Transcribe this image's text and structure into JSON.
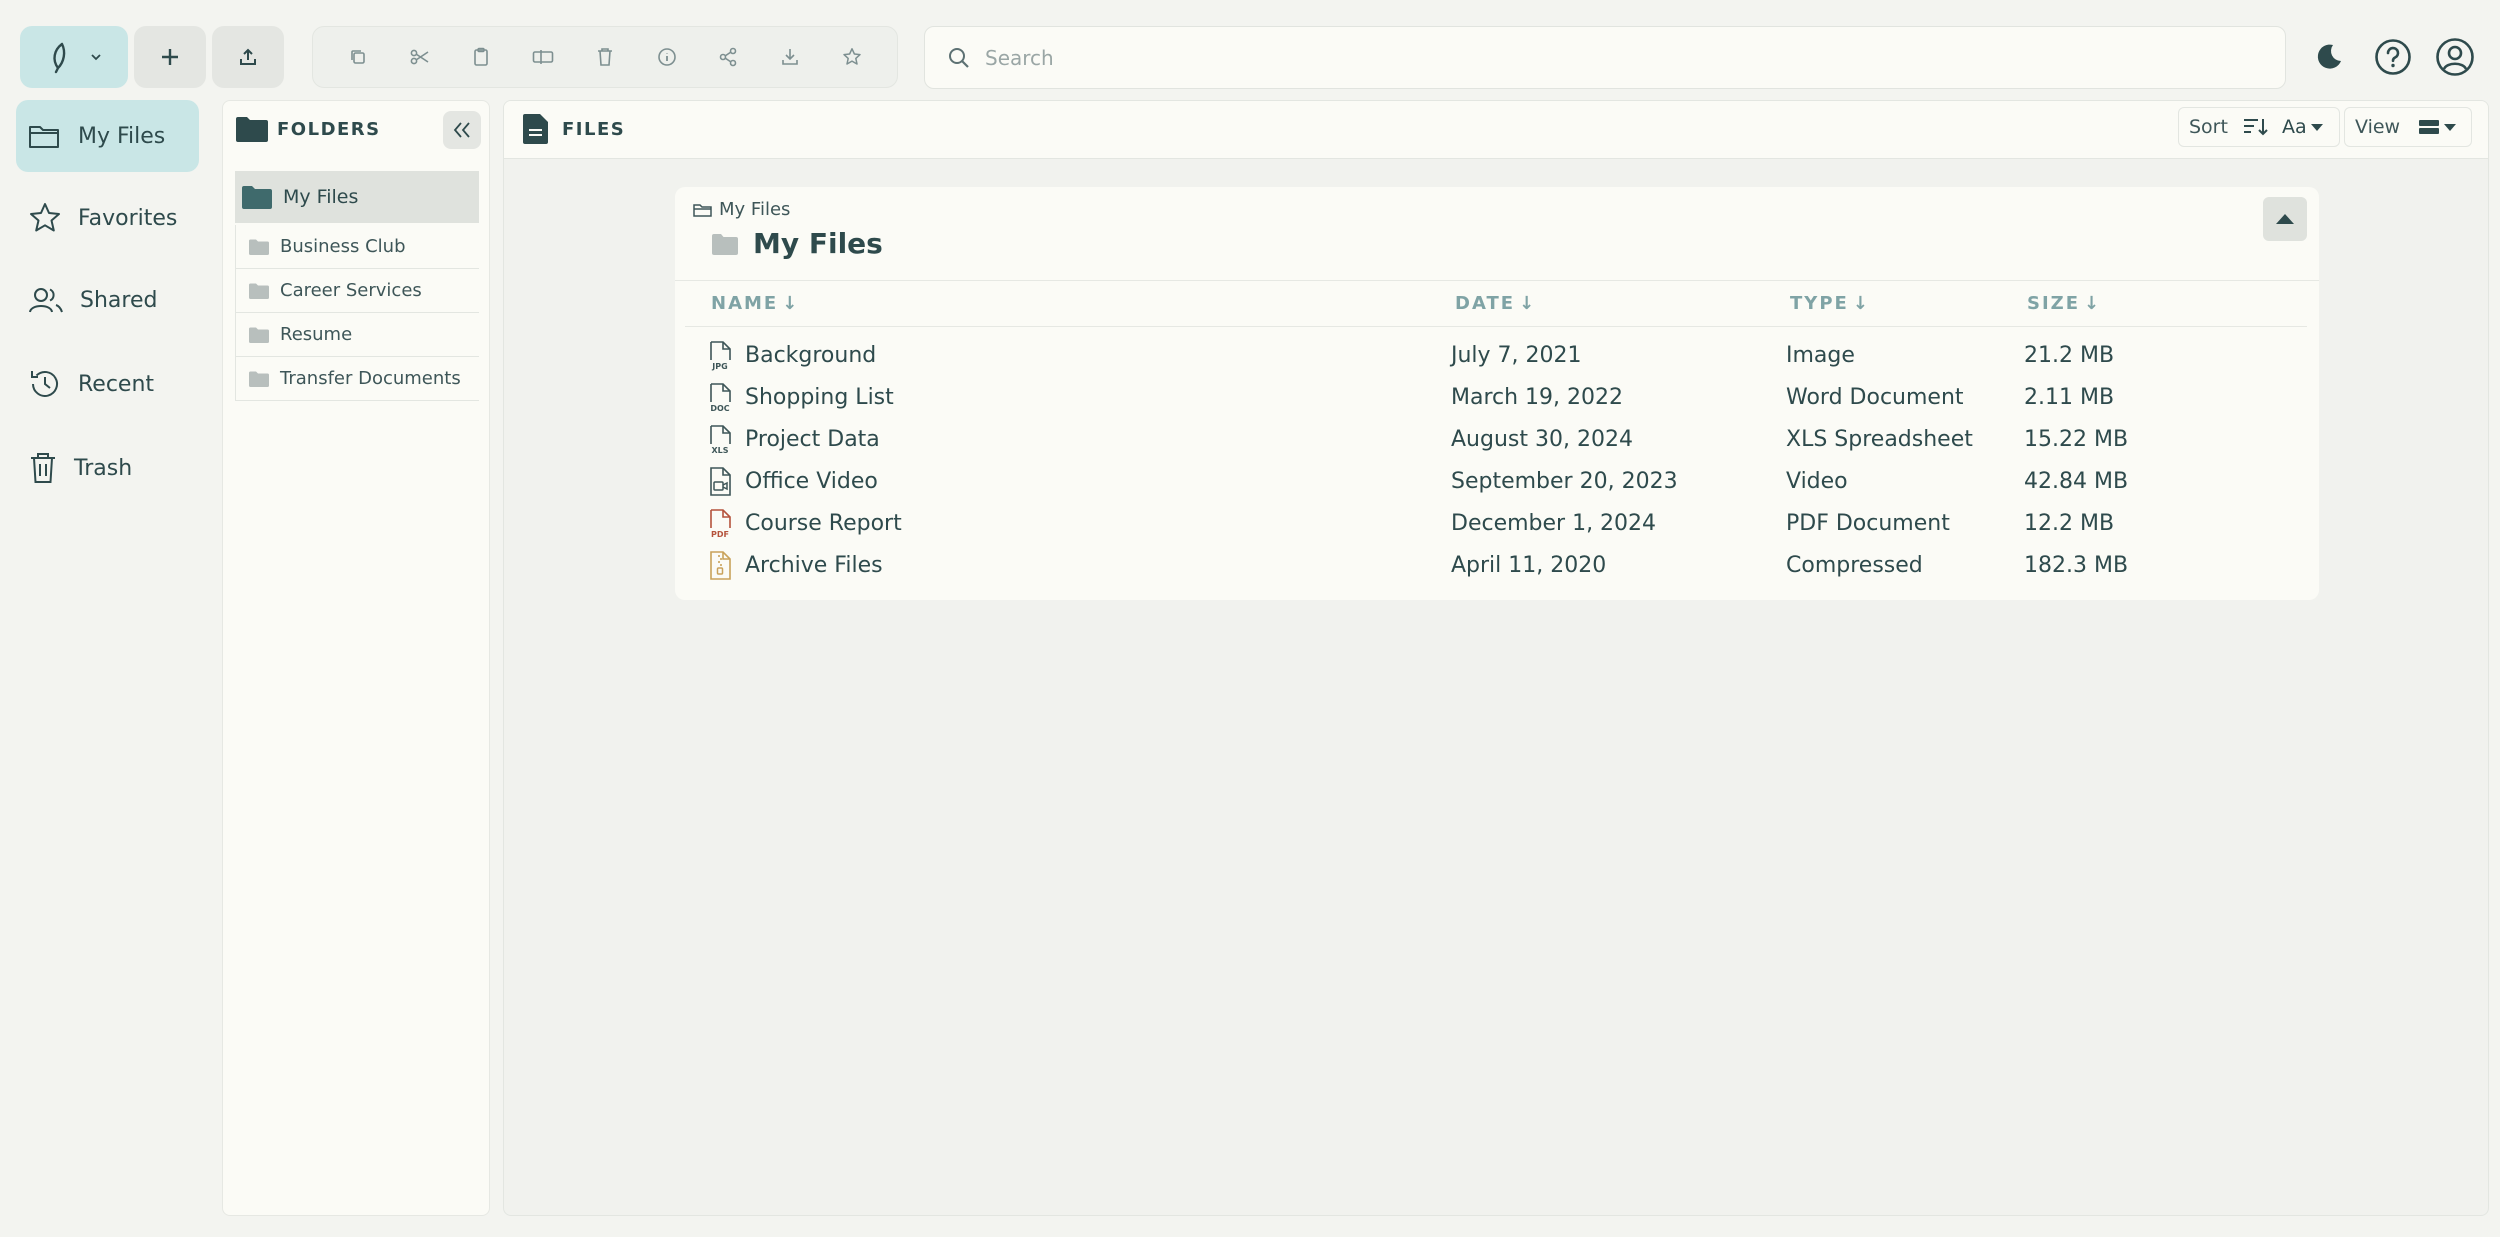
{
  "toolbar": {
    "new_tooltip": "",
    "actions": [
      "copy-icon",
      "scissors-icon",
      "clipboard-icon",
      "rename-icon",
      "delete-icon",
      "info-icon",
      "share-icon",
      "download-icon",
      "star-icon"
    ]
  },
  "search": {
    "placeholder": "Search",
    "value": ""
  },
  "nav": {
    "items": [
      {
        "label": "My Files",
        "icon": "folder-icon",
        "active": true
      },
      {
        "label": "Favorites",
        "icon": "star-icon",
        "active": false
      },
      {
        "label": "Shared",
        "icon": "users-icon",
        "active": false
      },
      {
        "label": "Recent",
        "icon": "history-icon",
        "active": false
      },
      {
        "label": "Trash",
        "icon": "trash-icon",
        "active": false
      }
    ]
  },
  "folders": {
    "title": "FOLDERS",
    "selected": "My Files",
    "items": [
      "Business Club",
      "Career Services",
      "Resume",
      "Transfer Documents"
    ]
  },
  "files_panel": {
    "title": "FILES",
    "sort_label": "Sort",
    "case_label": "Aa",
    "view_label": "View"
  },
  "card": {
    "breadcrumb": "My Files",
    "title": "My Files",
    "columns": {
      "name": "NAME",
      "date": "DATE",
      "type": "TYPE",
      "size": "SIZE"
    },
    "files": [
      {
        "name": "Background",
        "date": "July 7, 2021",
        "type": "Image",
        "size": "21.2 MB",
        "icon": "jpg-file-icon",
        "badge": "JPG"
      },
      {
        "name": "Shopping List",
        "date": "March 19, 2022",
        "type": "Word Document",
        "size": "2.11 MB",
        "icon": "doc-file-icon",
        "badge": "DOC"
      },
      {
        "name": "Project Data",
        "date": "August 30, 2024",
        "type": "XLS Spreadsheet",
        "size": "15.22 MB",
        "icon": "xls-file-icon",
        "badge": "XLS"
      },
      {
        "name": "Office Video",
        "date": "September 20, 2023",
        "type": "Video",
        "size": "42.84 MB",
        "icon": "video-file-icon",
        "badge": ""
      },
      {
        "name": "Course Report",
        "date": "December 1, 2024",
        "type": "PDF Document",
        "size": "12.2 MB",
        "icon": "pdf-file-icon",
        "badge": "PDF"
      },
      {
        "name": "Archive Files",
        "date": "April 11, 2020",
        "type": "Compressed",
        "size": "182.3 MB",
        "icon": "zip-file-icon",
        "badge": ""
      }
    ]
  },
  "colors": {
    "accent": "#c9e6e6",
    "text": "#2e4a4c",
    "header_text": "#7fa3a5",
    "pdf": "#b5533c",
    "zip": "#c9a25a"
  }
}
